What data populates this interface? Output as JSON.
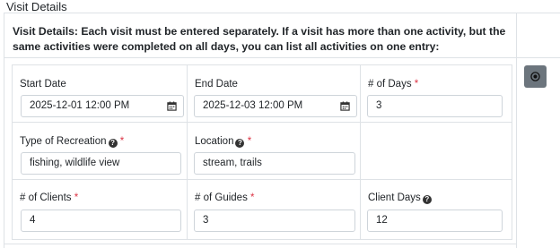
{
  "section_title": "Visit Details",
  "instructions": "Visit Details: Each visit must be entered separately. If a visit has more than one activity, but the same activities were completed on all days, you can list all activities on one entry:",
  "fields": {
    "start_date": {
      "label": "Start Date",
      "value": "2025-12-01 12:00 PM"
    },
    "end_date": {
      "label": "End Date",
      "value": "2025-12-03 12:00 PM"
    },
    "num_days": {
      "label": "# of Days",
      "required": "*",
      "value": "3"
    },
    "type_of_recreation": {
      "label": "Type of Recreation",
      "required": "*",
      "value": "fishing, wildlife view"
    },
    "location": {
      "label": "Location",
      "required": "*",
      "value": "stream, trails"
    },
    "num_clients": {
      "label": "# of Clients",
      "required": "*",
      "value": "4"
    },
    "num_guides": {
      "label": "# of Guides",
      "required": "*",
      "value": "3"
    },
    "client_days": {
      "label": "Client Days",
      "value": "12"
    }
  },
  "icons": {
    "calendar": "calendar-icon",
    "help": "question-circle-icon",
    "remove": "remove-circle-icon"
  },
  "colors": {
    "required": "#dc3545",
    "remove_button_bg": "#6c757d",
    "border": "#dee2e6"
  }
}
